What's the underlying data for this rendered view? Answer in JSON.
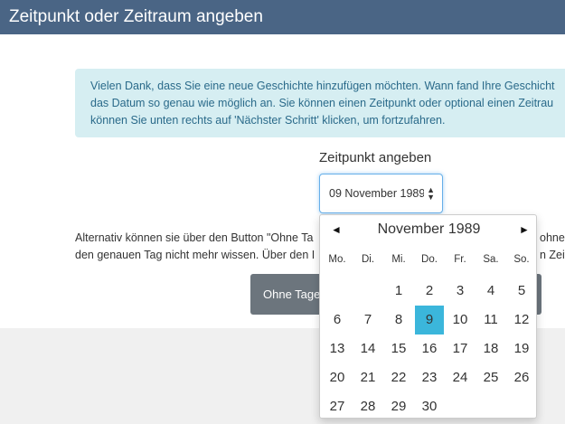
{
  "window": {
    "title": "Zeitpunkt oder Zeitraum angeben"
  },
  "alert": {
    "lines": [
      "Vielen Dank, dass Sie eine neue Geschichte hinzufügen möchten. Wann fand Ihre Geschicht",
      "das Datum so genau wie möglich an. Sie können einen Zeitpunkt oder optional einen Zeitrau",
      "können Sie unten rechts auf 'Nächster Schritt' klicken, um fortzufahren."
    ]
  },
  "date_field": {
    "label": "Zeitpunkt angeben",
    "value": "09 November 1989"
  },
  "alternative": {
    "lines": [
      "Alternativ können sie über den Button \"Ohne Ta",
      "den genauen Tag nicht mehr wissen. Über den I"
    ],
    "right_lines": [
      "ohne",
      "n Zeitr"
    ]
  },
  "buttons": {
    "no_day": "Ohne Tage"
  },
  "calendar": {
    "month_label": "November 1989",
    "prev": "◄",
    "next": "►",
    "weekdays": [
      "Mo.",
      "Di.",
      "Mi.",
      "Do.",
      "Fr.",
      "Sa.",
      "So."
    ],
    "weeks": [
      [
        "",
        "",
        "1",
        "2",
        "3",
        "4",
        "5"
      ],
      [
        "6",
        "7",
        "8",
        "9",
        "10",
        "11",
        "12"
      ],
      [
        "13",
        "14",
        "15",
        "16",
        "17",
        "18",
        "19"
      ],
      [
        "20",
        "21",
        "22",
        "23",
        "24",
        "25",
        "26"
      ],
      [
        "27",
        "28",
        "29",
        "30",
        "",
        "",
        ""
      ]
    ],
    "selected_day": "9",
    "accent_color": "#3bb6db"
  }
}
